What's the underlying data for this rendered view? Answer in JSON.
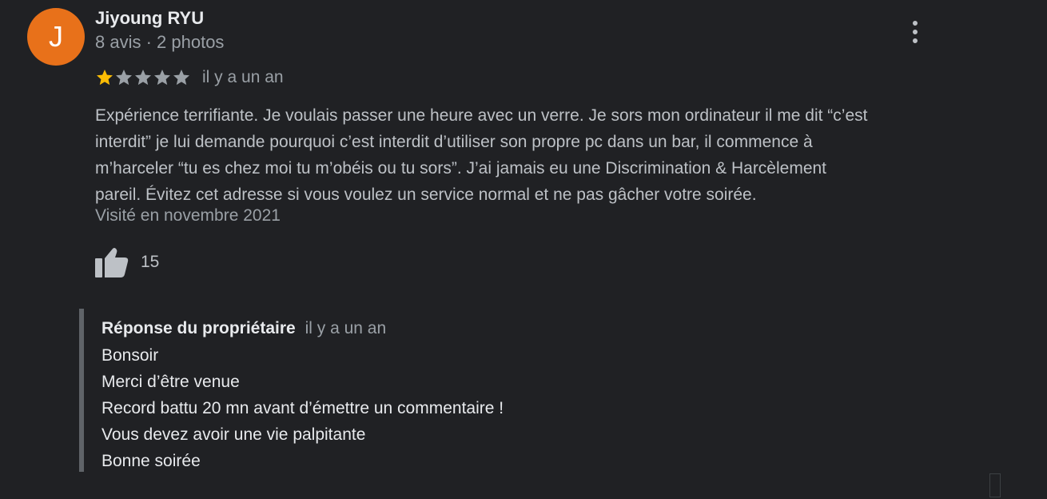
{
  "review": {
    "author": {
      "initial": "J",
      "name": "Jiyoung RYU",
      "meta": "8 avis · 2 photos",
      "avatar_color": "#e8711a"
    },
    "rating": {
      "value": 1,
      "max": 5,
      "filled_color": "#fbbc04",
      "empty_color": "#9aa0a6"
    },
    "date": "il y a un an",
    "text_lines": [
      "Expérience terrifiante. Je voulais passer une heure avec un verre. Je sors mon ordinateur il me dit “c’est",
      "interdit” je lui demande pourquoi c’est interdit d’utiliser son propre pc dans un bar, il commence à",
      "m’harceler “tu es chez moi tu m’obéis ou tu sors”.  J’ai jamais eu une Discrimination & Harcèlement",
      "pareil. Évitez cet adresse si vous voulez un service normal et ne pas gâcher votre soirée."
    ],
    "visit": "Visité en novembre 2021",
    "likes": "15",
    "menu_icon": "more-vert-icon",
    "like_icon": "thumb-up-icon"
  },
  "owner_response": {
    "title": "Réponse du propriétaire",
    "date": "il y a un an",
    "lines": [
      "Bonsoir",
      "Merci d’être venue",
      "Record battu 20 mn avant d’émettre un commentaire !",
      "Vous devez avoir une vie palpitante",
      "Bonne soirée"
    ]
  }
}
